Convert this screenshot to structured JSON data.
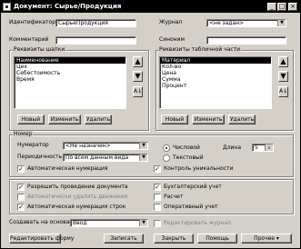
{
  "window": {
    "title": "Документ: Сырье/Продукция"
  },
  "form": {
    "identifier_label": "Идентификатор",
    "identifier_value": "СырьеПродукция",
    "comment_label": "Комментарий",
    "journal_label": "Журнал",
    "journal_value": "<не задан>",
    "synonym_label": "Синоним"
  },
  "header_props": {
    "title": "Реквизиты шапки",
    "items": [
      "Наименование",
      "Цех",
      "Себестоимость",
      "Время"
    ],
    "buttons": {
      "new": "Новый",
      "edit": "Изменить",
      "delete": "Удалить"
    }
  },
  "table_props": {
    "title": "Реквизиты табличной части",
    "items": [
      "Материал",
      "Кол-во",
      "Цена",
      "Сумма",
      "Процент"
    ],
    "buttons": {
      "new": "Новый",
      "edit": "Изменить",
      "delete": "Удалить"
    }
  },
  "numbering": {
    "title": "Номер",
    "numerator_label": "Нумератор",
    "numerator_value": "<Не назначен>",
    "periodicity_label": "Периодичность",
    "periodicity_value": "По всем данным вида",
    "type_numeric": "Числовой",
    "type_text": "Текстовый",
    "length_label": "Длина",
    "length_value": "5",
    "auto_numbering": "Автоматическая нумерация",
    "uniqueness_control": "Контроль уникальности"
  },
  "options": {
    "allow_posting": "Разрешить проведение документа",
    "auto_delete_movements": "Автоматически удалять движения",
    "auto_numbering_lines": "Автоматическая нумерация строк",
    "accounting": "Бухгалтерский учет",
    "calculation": "Расчет",
    "operational": "Оперативный учет"
  },
  "bottom": {
    "create_on_label": "Создавать на основании",
    "create_on_value": "Ввод",
    "edit_journal": "Редактировать журнал"
  },
  "footer": {
    "edit_form": "Редактировать форму",
    "save": "Записать",
    "close": "Закрыть",
    "help": "Помощь",
    "other": "Прочее"
  }
}
